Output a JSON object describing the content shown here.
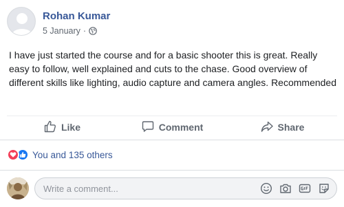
{
  "post": {
    "author": "Rohan Kumar",
    "date": "5 January",
    "separator": "·",
    "privacy_icon": "globe-icon",
    "text": "I have just started the course and for a basic shooter this is great. Really easy to follow, well explained and cuts to the chase. Good overview of different skills like lighting, audio capture and camera angles. Recommended"
  },
  "actions": {
    "like": "Like",
    "comment": "Comment",
    "share": "Share"
  },
  "reactions": {
    "icons": [
      "love-reaction-icon",
      "like-reaction-icon"
    ],
    "summary": "You and 135 others"
  },
  "comment_box": {
    "placeholder": "Write a comment...",
    "icons": [
      "emoji-icon",
      "camera-icon",
      "gif-icon",
      "sticker-icon"
    ]
  },
  "colors": {
    "link_blue": "#385898",
    "like_blue": "#1877f2",
    "love_red": "#f33e58",
    "muted": "#606770"
  }
}
